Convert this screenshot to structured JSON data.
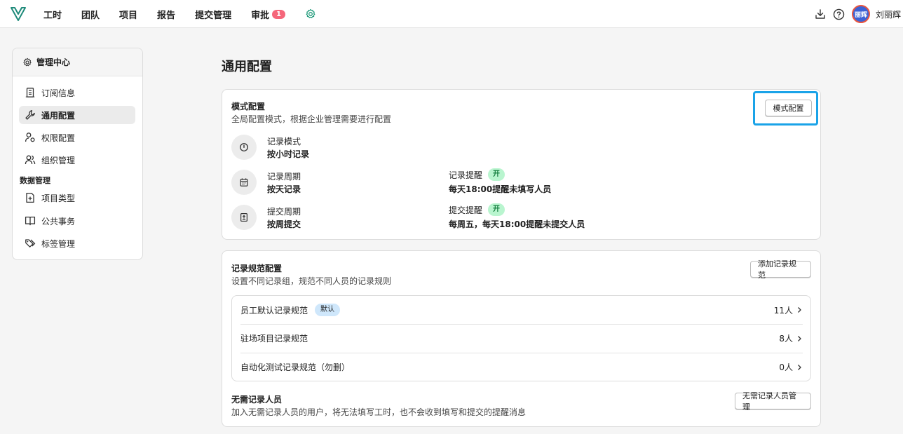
{
  "nav": {
    "items": [
      "工时",
      "团队",
      "项目",
      "报告",
      "提交管理",
      "审批"
    ],
    "approval_badge": "1",
    "icons": {
      "logo": "vv-logo-icon",
      "settings": "gear-icon",
      "download": "download-icon",
      "help": "help-icon"
    }
  },
  "user": {
    "avatar_text": "丽辉",
    "name": "刘丽辉"
  },
  "sidebar": {
    "title": "管理中心",
    "items": [
      {
        "label": "订阅信息",
        "icon": "building-icon"
      },
      {
        "label": "通用配置",
        "icon": "wrench-icon"
      },
      {
        "label": "权限配置",
        "icon": "user-key-icon"
      },
      {
        "label": "组织管理",
        "icon": "users-icon"
      }
    ],
    "group_label": "数据管理",
    "group_items": [
      {
        "label": "项目类型",
        "icon": "file-plus-icon"
      },
      {
        "label": "公共事务",
        "icon": "book-icon"
      },
      {
        "label": "标签管理",
        "icon": "tags-icon"
      }
    ]
  },
  "page": {
    "title": "通用配置"
  },
  "mode_card": {
    "title": "模式配置",
    "subtitle": "全局配置模式，根据企业管理需要进行配置",
    "button": "模式配置",
    "record_mode": {
      "label": "记录模式",
      "value": "按小时记录"
    },
    "record_period": {
      "label": "记录周期",
      "value": "按天记录"
    },
    "record_reminder": {
      "label": "记录提醒",
      "badge": "开",
      "value": "每天18:00提醒未填写人员"
    },
    "submit_period": {
      "label": "提交周期",
      "value": "按周提交"
    },
    "submit_reminder": {
      "label": "提交提醒",
      "badge": "开",
      "value": "每周五，每天18:00提醒未提交人员"
    }
  },
  "rules_card": {
    "title": "记录规范配置",
    "subtitle": "设置不同记录组，规范不同人员的记录规则",
    "add_button": "添加记录规范",
    "rules": [
      {
        "name": "员工默认记录规范",
        "badge": "默认",
        "count": "11人"
      },
      {
        "name": "驻场项目记录规范",
        "count": "8人"
      },
      {
        "name": "自动化测试记录规范（勿删）",
        "count": "0人"
      }
    ],
    "exempt_title": "无需记录人员",
    "exempt_subtitle": "加入无需记录人员的用户，将无法填写工时，也不会收到填写和提交的提醒消息",
    "exempt_button": "无需记录人员管理"
  },
  "colors": {
    "focus": "#1aa3e8",
    "badge_red": "#f5667a",
    "on_green": "#b9f5cf",
    "default_blue": "#cfe7fb"
  }
}
